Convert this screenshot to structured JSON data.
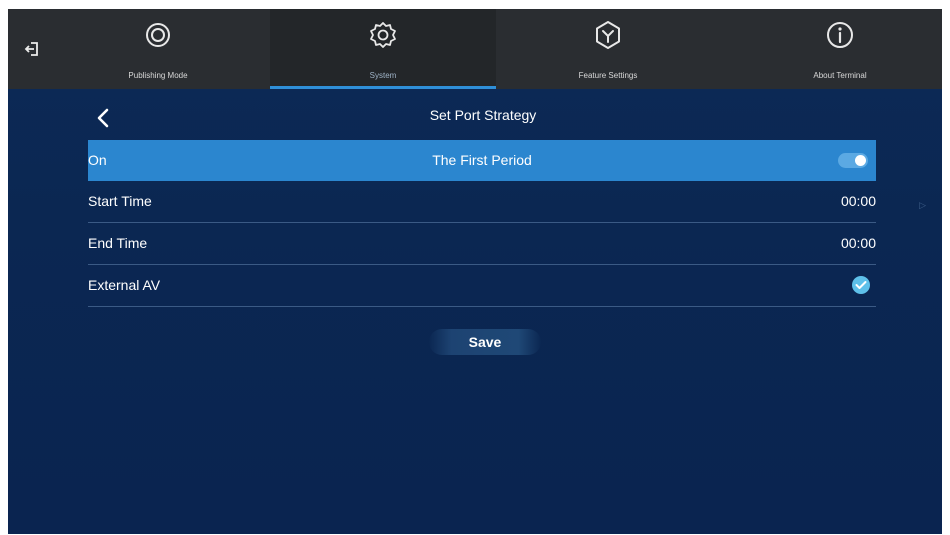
{
  "nav": {
    "tabs": [
      {
        "label": "Publishing Mode",
        "icon": "publishing-mode-icon"
      },
      {
        "label": "System",
        "icon": "gear-icon",
        "active": true
      },
      {
        "label": "Feature Settings",
        "icon": "feature-settings-icon"
      },
      {
        "label": "About Terminal",
        "icon": "info-icon"
      }
    ]
  },
  "header": {
    "title": "Set Port Strategy"
  },
  "period": {
    "state_label": "On",
    "title": "The First Period",
    "enabled": true
  },
  "rows": [
    {
      "label": "Start Time",
      "value": "00:00"
    },
    {
      "label": "End Time",
      "value": "00:00"
    },
    {
      "label": "External AV",
      "checked": true
    }
  ],
  "save_label": "Save",
  "colors": {
    "background": "#0b2752",
    "topbar": "#2a2d31",
    "accent": "#2b86cf",
    "toggle": "#5ba9e3",
    "check": "#5ec0ea"
  }
}
